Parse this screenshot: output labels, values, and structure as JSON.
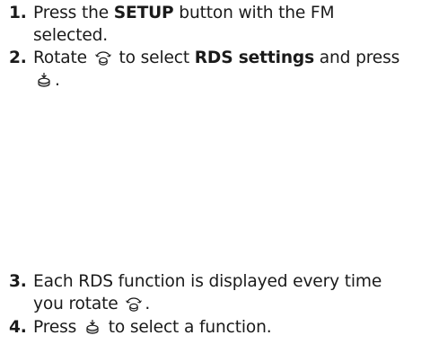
{
  "steps": [
    {
      "number": "1.",
      "text_before": "Press the ",
      "bold": "SETUP",
      "text_after_line1": " button with the FM",
      "line2": "selected."
    },
    {
      "number": "2.",
      "text_before": "Rotate ",
      "icon1": "selector-knob-rotate-icon",
      "text_mid": " to select ",
      "bold": "RDS settings",
      "text_after_line1": " and press",
      "icon2": "selector-knob-press-icon",
      "line2_suffix": "."
    },
    {
      "number": "3.",
      "line1": "Each RDS function is displayed every time",
      "line2_prefix": "you rotate ",
      "icon": "selector-knob-rotate-icon",
      "line2_suffix": "."
    },
    {
      "number": "4.",
      "text_before": "Press ",
      "icon": "selector-knob-press-icon",
      "text_after": " to select a function."
    }
  ]
}
